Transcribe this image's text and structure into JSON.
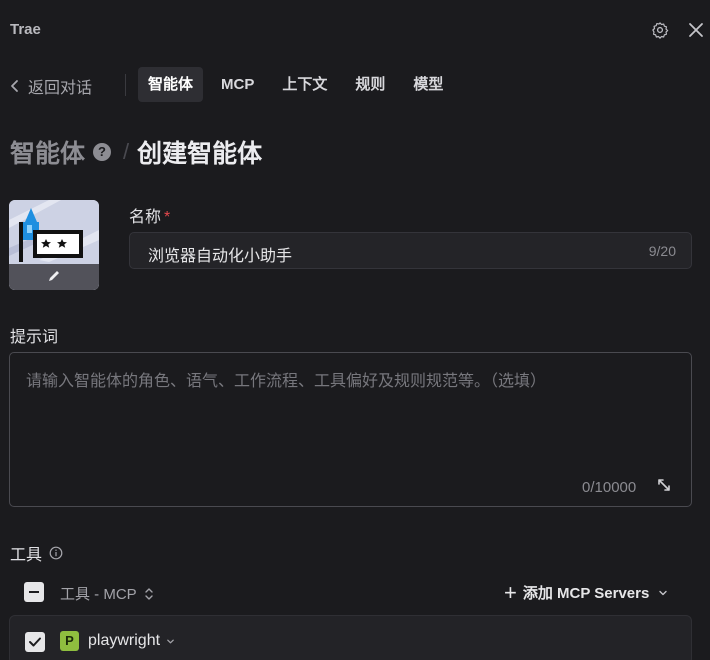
{
  "app": {
    "title": "Trae"
  },
  "icons": {
    "settings": "gear-icon",
    "close": "close-icon",
    "back": "chevron-left-icon",
    "help": "question-circle-icon",
    "edit": "pencil-icon",
    "expand": "expand-icon",
    "info": "info-circle-icon",
    "sort": "sort-updown-icon",
    "add": "plus-icon",
    "dropdown": "chevron-down-icon",
    "checked": "checkmark-icon"
  },
  "nav": {
    "back_label": "返回对话",
    "tabs": [
      {
        "label": "智能体",
        "active": true
      },
      {
        "label": "MCP",
        "active": false
      },
      {
        "label": "上下文",
        "active": false
      },
      {
        "label": "规则",
        "active": false
      },
      {
        "label": "模型",
        "active": false
      }
    ]
  },
  "breadcrumb": {
    "parent": "智能体",
    "help_glyph": "?",
    "separator": "/",
    "current": "创建智能体"
  },
  "form": {
    "name": {
      "label": "名称",
      "required_mark": "*",
      "value": "浏览器自动化小助手",
      "counter": "9/20"
    },
    "prompt": {
      "label": "提示词",
      "placeholder": "请输入智能体的角色、语气、工作流程、工具偏好及规则规范等。（选填）",
      "counter": "0/10000"
    }
  },
  "tools": {
    "label": "工具",
    "header_label": "工具 - MCP",
    "add_button_plus": "+",
    "add_button_label": "添加 MCP Servers",
    "items": [
      {
        "badge": "P",
        "name": "playwright",
        "checked": true,
        "badge_color": "#8fbe3f"
      }
    ]
  },
  "colors": {
    "background": "#1b1b1e",
    "active_tab": "#2e2e33",
    "required": "#e5484d",
    "badge_green": "#8fbe3f"
  }
}
